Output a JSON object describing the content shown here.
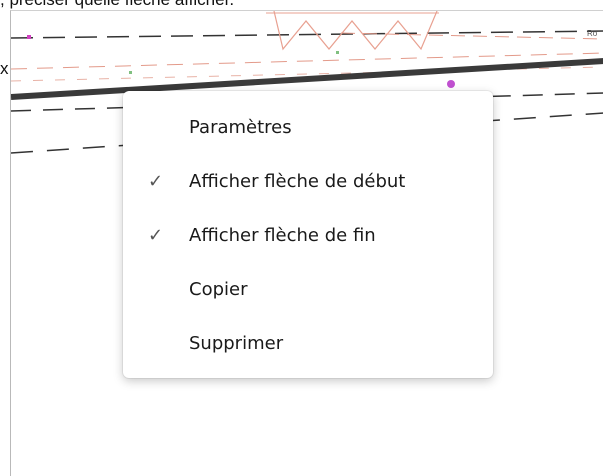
{
  "page": {
    "instruction_text": ", préciser quelle flèche afficher.",
    "side_text": "x"
  },
  "drawing": {
    "road_label": "Ro"
  },
  "context_menu": {
    "items": [
      {
        "label": "Paramètres",
        "checked": false
      },
      {
        "label": "Afficher flèche de début",
        "checked": true
      },
      {
        "label": "Afficher flèche de fin",
        "checked": true
      },
      {
        "label": "Copier",
        "checked": false
      },
      {
        "label": "Supprimer",
        "checked": false
      }
    ],
    "check_glyph": "✓"
  }
}
